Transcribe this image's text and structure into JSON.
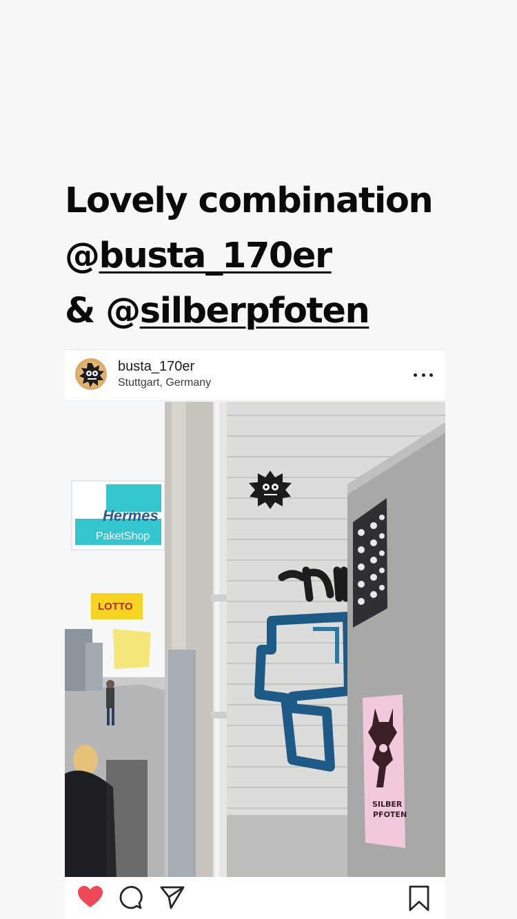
{
  "story": {
    "caption": {
      "line1": "Lovely combination",
      "line2_prefix": "@",
      "line2_mention": "busta_170er",
      "line3_prefix": "& @",
      "line3_mention": "silberpfoten"
    }
  },
  "post": {
    "username": "busta_170er",
    "location": "Stuttgart, Germany",
    "photo": {
      "sign_hermes": "Hermes",
      "sign_paketshop": "PaketShop",
      "sign_lotto": "LOTTO",
      "sticker_text": "SILBER PFOTEN"
    },
    "liked": true
  },
  "icons": {
    "more": "more-options-icon",
    "like": "heart-icon",
    "comment": "comment-icon",
    "share": "share-icon",
    "save": "bookmark-icon"
  },
  "colors": {
    "heart": "#ed4956",
    "text": "#0a0a0a",
    "background": "#f7f7f7"
  }
}
